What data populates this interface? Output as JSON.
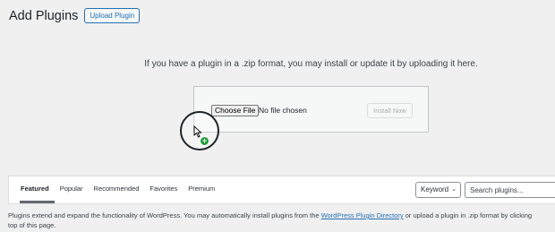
{
  "header": {
    "title": "Add Plugins",
    "upload_button": "Upload Plugin"
  },
  "upload": {
    "help_text": "If you have a plugin in a .zip format, you may install or update it by uploading it here.",
    "choose_file_label": "Choose File",
    "file_status": "No file chosen",
    "install_button": "Install Now"
  },
  "filter": {
    "tabs": [
      {
        "label": "Featured",
        "current": true
      },
      {
        "label": "Popular"
      },
      {
        "label": "Recommended"
      },
      {
        "label": "Favorites"
      },
      {
        "label": "Premium"
      }
    ],
    "search_type": "Keyword",
    "search_placeholder": "Search plugins..."
  },
  "description": {
    "before_link": "Plugins extend and expand the functionality of WordPress. You may automatically install plugins from the ",
    "link_text": "WordPress Plugin Directory",
    "after_link": " or upload a plugin in .zip format by clicking",
    "second_line": "top of this page."
  },
  "colors": {
    "accent": "#2271b1",
    "background": "#f0f0f1",
    "cursor_plus": "#1f9d3a"
  }
}
